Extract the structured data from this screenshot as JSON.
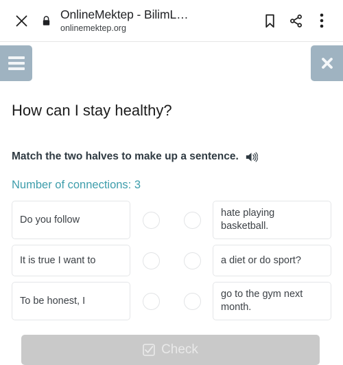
{
  "browser": {
    "close_icon": "close-icon",
    "lock_icon": "lock-icon",
    "title": "OnlineMektep - BilimL…",
    "url": "onlinemektep.org",
    "bookmark_icon": "bookmark-icon",
    "share_icon": "share-icon",
    "menu_icon": "more-vertical-icon"
  },
  "page_header": {
    "menu_icon": "hamburger-menu-icon",
    "close_icon": "close-icon",
    "button_color": "#9fb3c1"
  },
  "main": {
    "question_title": "How can I stay healthy?",
    "instruction": "Match the two halves to make up a sentence.",
    "speaker_icon": "speaker-icon",
    "connections_label": "Number of connections: 3",
    "connections_count": 3,
    "connections_color": "#3d9dab",
    "rows": [
      {
        "left": "Do you follow",
        "right": "hate playing basketball."
      },
      {
        "left": "It is true I want to",
        "right": "a diet or do sport?"
      },
      {
        "left": "To be honest, I",
        "right": "go to the gym next month."
      }
    ]
  },
  "footer": {
    "check_label": "Check",
    "check_icon": "checkbox-checked-icon",
    "check_enabled": false,
    "check_color": "#c9c9c9"
  }
}
